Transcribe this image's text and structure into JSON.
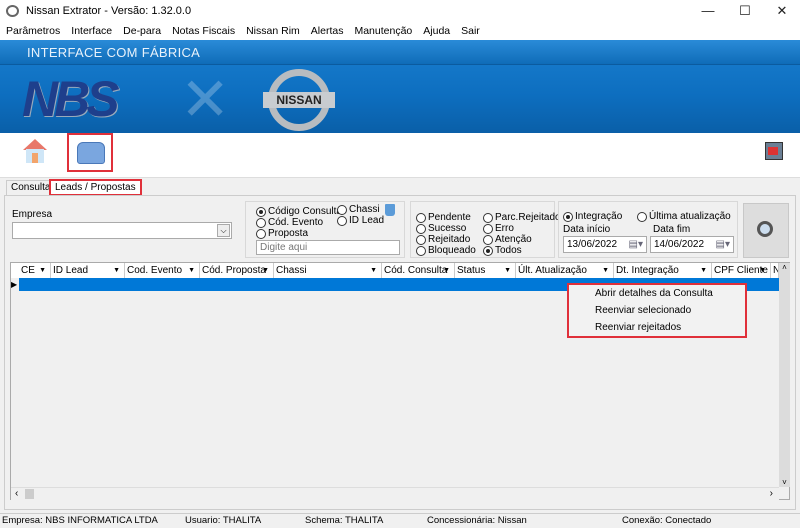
{
  "window": {
    "title": "Nissan Extrator - Versão: 1.32.0.0",
    "minimize": "—",
    "maximize": "☐",
    "close": "✕"
  },
  "menu": [
    "Parâmetros",
    "Interface",
    "De-para",
    "Notas Fiscais",
    "Nissan Rim",
    "Alertas",
    "Manutenção",
    "Ajuda",
    "Sair"
  ],
  "banner": {
    "heading": "INTERFACE COM FÁBRICA",
    "logo_text": "NBS",
    "partner_logo": "NISSAN"
  },
  "toolbar": {
    "icons": [
      "home-icon",
      "car-icon",
      "exit-icon"
    ]
  },
  "tabs": [
    {
      "label": "Consultas"
    },
    {
      "label": "Leads / Propostas",
      "active": true
    }
  ],
  "filters": {
    "empresa_label": "Empresa",
    "empresa_value": "",
    "search_type": {
      "options": [
        "Código Consulta",
        "Cód. Evento",
        "Proposta",
        "Chassi",
        "ID Lead"
      ],
      "selected": "Código Consulta"
    },
    "search_placeholder": "Digite aqui",
    "status": {
      "options": [
        "Pendente",
        "Sucesso",
        "Rejeitado",
        "Bloqueado",
        "Parc.Rejeitado",
        "Erro",
        "Atenção",
        "Todos"
      ],
      "selected": "Todos"
    },
    "date_type": {
      "options": [
        "Integração",
        "Última atualização"
      ],
      "selected": "Integração"
    },
    "data_inicio_label": "Data início",
    "data_inicio": "13/06/2022",
    "data_fim_label": "Data fim",
    "data_fim": "14/06/2022"
  },
  "grid": {
    "columns": [
      "CE",
      "ID Lead",
      "Cod. Evento",
      "Cód. Proposta",
      "Chassi",
      "Cód. Consulta",
      "Status",
      "Últ. Atualização",
      "Dt. Integração",
      "CPF Cliente",
      "N"
    ],
    "rows": [
      [
        "",
        "",
        "",
        "",
        "",
        "",
        "",
        "",
        "",
        "",
        ""
      ]
    ]
  },
  "context_menu": [
    "Abrir detalhes da Consulta",
    "Reenviar selecionado",
    "Reenviar rejeitados"
  ],
  "statusbar": {
    "empresa": "Empresa: NBS INFORMATICA LTDA",
    "usuario": "Usuario: THALITA",
    "schema": "Schema: THALITA",
    "concessionaria": "Concessionária: Nissan",
    "conexao": "Conexão: Conectado"
  },
  "colors": {
    "selection": "#0078d7",
    "banner": "#0d6ebf",
    "highlight": "#e0303a"
  }
}
